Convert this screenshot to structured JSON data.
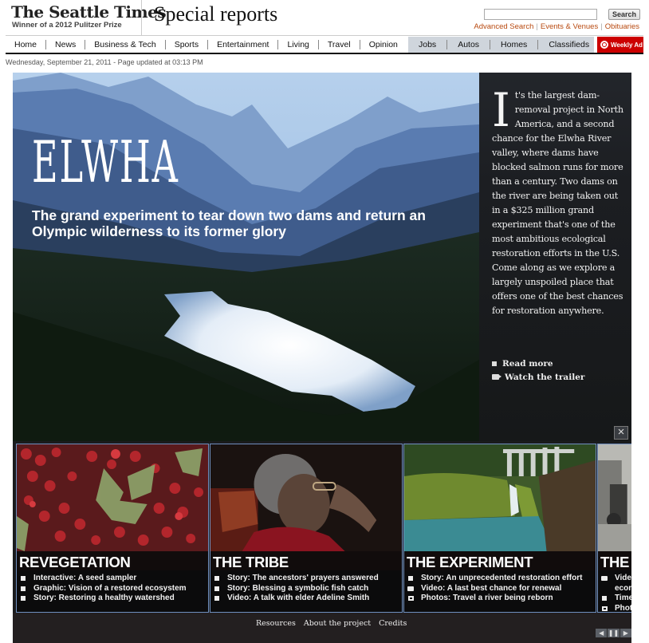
{
  "header": {
    "logo_title": "The Seattle Times",
    "logo_subtitle": "Winner of a 2012 Pulitzer Prize",
    "section_title": "Special reports",
    "search_button": "Search",
    "search_value": "",
    "util_links": [
      "Advanced Search",
      "Events & Venues",
      "Obituaries"
    ]
  },
  "nav": {
    "main": [
      "Home",
      "News",
      "Business & Tech",
      "Sports",
      "Entertainment",
      "Living",
      "Travel",
      "Opinion"
    ],
    "classifieds": [
      "Jobs",
      "Autos",
      "Homes",
      "Classifieds"
    ],
    "weekly_ad": "Weekly Ad"
  },
  "date_line": "Wednesday, September 21, 2011 - Page updated at 03:13 PM",
  "hero": {
    "title": "ELWHA",
    "subtitle": "The grand experiment to tear down two dams and return an Olympic wilderness to its former glory",
    "intro_dropcap": "I",
    "intro_text": "t's the largest dam-removal project in North America, and a second chance for the Elwha River valley, where dams have blocked salmon runs for more than a century. Two dams on the river are being taken out in a $325 million grand experiment that's one of the most ambitious ecological restoration efforts in the U.S. Come along as we explore a largely unspoiled place that offers one of the best chances for restoration anywhere.",
    "links": [
      {
        "label": "Read more",
        "icon": "square-bullet-icon"
      },
      {
        "label": "Watch the trailer",
        "icon": "video-camera-icon"
      }
    ],
    "close_label": "×"
  },
  "tiles": [
    {
      "title": "REVEGETATION",
      "items": [
        {
          "icon": "square",
          "label": "Interactive: A seed sampler"
        },
        {
          "icon": "square",
          "label": "Graphic: Vision of a restored ecosystem"
        },
        {
          "icon": "square",
          "label": "Story: Restoring a healthy watershed"
        }
      ]
    },
    {
      "title": "THE TRIBE",
      "items": [
        {
          "icon": "square",
          "label": "Story: The ancestors' prayers answered"
        },
        {
          "icon": "square",
          "label": "Story: Blessing a symbolic fish catch"
        },
        {
          "icon": "square",
          "label": "Video: A talk with elder Adeline Smith"
        }
      ]
    },
    {
      "title": "THE EXPERIMENT",
      "items": [
        {
          "icon": "square",
          "label": "Story: An unprecedented restoration effort"
        },
        {
          "icon": "camera",
          "label": "Video: A last best chance for renewal"
        },
        {
          "icon": "photo",
          "label": "Photos: Travel a river being reborn"
        }
      ]
    },
    {
      "title": "THE",
      "items": [
        {
          "icon": "camera",
          "label": "Video econ"
        },
        {
          "icon": "square",
          "label": "Time"
        },
        {
          "icon": "photo",
          "label": "Photo"
        }
      ]
    }
  ],
  "footer": {
    "links": [
      "Resources",
      "About the project",
      "Credits"
    ],
    "controls": {
      "prev": "◀",
      "pause": "❚❚",
      "next": "▶"
    }
  }
}
